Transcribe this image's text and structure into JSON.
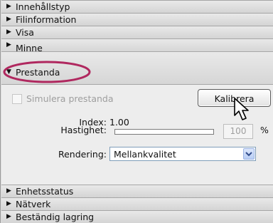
{
  "sections_top": [
    {
      "label": "Innehållstyp",
      "arrow": "▶"
    },
    {
      "label": "Filinformation",
      "arrow": "▶"
    },
    {
      "label": "Visa",
      "arrow": "▶"
    },
    {
      "label": "Minne",
      "arrow": "▶"
    }
  ],
  "expanded_section": {
    "label": "Prestanda",
    "arrow": "▼"
  },
  "panel": {
    "checkbox_label": "Simulera prestanda",
    "checkbox_checked": false,
    "calibrate_button": "Kalibrera",
    "index_label": "Index:",
    "index_value": "1.00",
    "speed_label": "Hastighet:",
    "speed_value": "100",
    "speed_unit": "%",
    "rendering_label": "Rendering:",
    "rendering_value": "Mellankvalitet"
  },
  "sections_bottom": [
    {
      "label": "Enhetsstatus",
      "arrow": "▶"
    },
    {
      "label": "Nätverk",
      "arrow": "▶"
    },
    {
      "label": "Beständig lagring",
      "arrow": "▶"
    }
  ],
  "colors": {
    "highlight_ring": "#b0285f"
  }
}
